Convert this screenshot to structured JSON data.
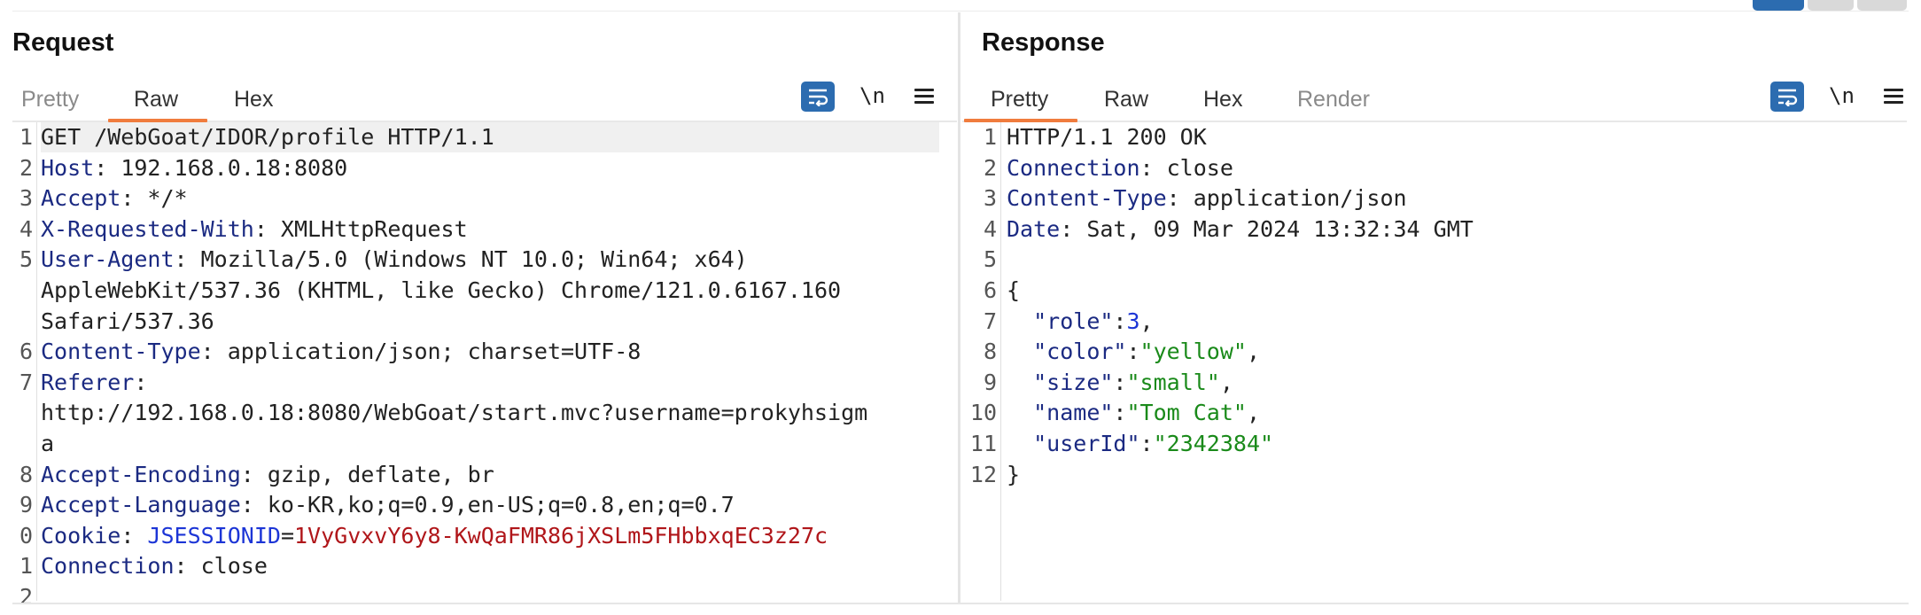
{
  "request": {
    "title": "Request",
    "tabs": [
      {
        "label": "Pretty",
        "muted": true
      },
      {
        "label": "Raw",
        "active": true
      },
      {
        "label": "Hex"
      }
    ],
    "newline_label": "\\n",
    "lines": [
      {
        "num": "1",
        "parts": [
          {
            "t": "GET /WebGoat/IDOR/profile HTTP/1.1",
            "c": "v"
          }
        ]
      },
      {
        "num": "2",
        "parts": [
          {
            "t": "Host",
            "c": "k"
          },
          {
            "t": ": 192.168.0.18:8080",
            "c": "v"
          }
        ]
      },
      {
        "num": "3",
        "parts": [
          {
            "t": "Accept",
            "c": "k"
          },
          {
            "t": ": */*",
            "c": "v"
          }
        ]
      },
      {
        "num": "4",
        "parts": [
          {
            "t": "X-Requested-With",
            "c": "k"
          },
          {
            "t": ": XMLHttpRequest",
            "c": "v"
          }
        ]
      },
      {
        "num": "5",
        "parts": [
          {
            "t": "User-Agent",
            "c": "k"
          },
          {
            "t": ": Mozilla/5.0 (Windows NT 10.0; Win64; x64)",
            "c": "v"
          }
        ]
      },
      {
        "num": "",
        "parts": [
          {
            "t": "AppleWebKit/537.36 (KHTML, like Gecko) Chrome/121.0.6167.160",
            "c": "v"
          }
        ]
      },
      {
        "num": "",
        "parts": [
          {
            "t": "Safari/537.36",
            "c": "v"
          }
        ]
      },
      {
        "num": "6",
        "parts": [
          {
            "t": "Content-Type",
            "c": "k"
          },
          {
            "t": ": application/json; charset=UTF-8",
            "c": "v"
          }
        ]
      },
      {
        "num": "7",
        "parts": [
          {
            "t": "Referer",
            "c": "k"
          },
          {
            "t": ":",
            "c": "v"
          }
        ]
      },
      {
        "num": "",
        "parts": [
          {
            "t": "http://192.168.0.18:8080/WebGoat/start.mvc?username=prokyhsigm",
            "c": "v"
          }
        ]
      },
      {
        "num": "",
        "parts": [
          {
            "t": "a",
            "c": "v"
          }
        ]
      },
      {
        "num": "8",
        "parts": [
          {
            "t": "Accept-Encoding",
            "c": "k"
          },
          {
            "t": ": gzip, deflate, br",
            "c": "v"
          }
        ]
      },
      {
        "num": "9",
        "parts": [
          {
            "t": "Accept-Language",
            "c": "k"
          },
          {
            "t": ": ko-KR,ko;q=0.9,en-US;q=0.8,en;q=0.7",
            "c": "v"
          }
        ]
      },
      {
        "num": "0",
        "parts": [
          {
            "t": "Cookie",
            "c": "k"
          },
          {
            "t": ": ",
            "c": "v"
          },
          {
            "t": "JSESSIONID",
            "c": "cookie-name"
          },
          {
            "t": "=",
            "c": "v"
          },
          {
            "t": "1VyGvxvY6y8-KwQaFMR86jXSLm5FHbbxqEC3z27c",
            "c": "cookie-val"
          }
        ]
      },
      {
        "num": "1",
        "parts": [
          {
            "t": "Connection",
            "c": "k"
          },
          {
            "t": ": close",
            "c": "v"
          }
        ]
      },
      {
        "num": "2",
        "parts": []
      }
    ]
  },
  "response": {
    "title": "Response",
    "tabs": [
      {
        "label": "Pretty",
        "active": true
      },
      {
        "label": "Raw"
      },
      {
        "label": "Hex"
      },
      {
        "label": "Render",
        "muted": true
      }
    ],
    "newline_label": "\\n",
    "lines": [
      {
        "num": "1",
        "parts": [
          {
            "t": "HTTP/1.1 200 OK",
            "c": "v"
          }
        ]
      },
      {
        "num": "2",
        "parts": [
          {
            "t": "Connection",
            "c": "k"
          },
          {
            "t": ": close",
            "c": "v"
          }
        ]
      },
      {
        "num": "3",
        "parts": [
          {
            "t": "Content-Type",
            "c": "k"
          },
          {
            "t": ": application/json",
            "c": "v"
          }
        ]
      },
      {
        "num": "4",
        "parts": [
          {
            "t": "Date",
            "c": "k"
          },
          {
            "t": ": Sat, 09 Mar 2024 13:32:34 GMT",
            "c": "v"
          }
        ]
      },
      {
        "num": "5",
        "parts": []
      },
      {
        "num": "6",
        "parts": [
          {
            "t": "{",
            "c": "v"
          }
        ]
      },
      {
        "num": "7",
        "parts": [
          {
            "t": "  ",
            "c": "v"
          },
          {
            "t": "\"role\"",
            "c": "jkey"
          },
          {
            "t": ":",
            "c": "v"
          },
          {
            "t": "3",
            "c": "jnum"
          },
          {
            "t": ",",
            "c": "v"
          }
        ]
      },
      {
        "num": "8",
        "parts": [
          {
            "t": "  ",
            "c": "v"
          },
          {
            "t": "\"color\"",
            "c": "jkey"
          },
          {
            "t": ":",
            "c": "v"
          },
          {
            "t": "\"yellow\"",
            "c": "jstr"
          },
          {
            "t": ",",
            "c": "v"
          }
        ]
      },
      {
        "num": "9",
        "parts": [
          {
            "t": "  ",
            "c": "v"
          },
          {
            "t": "\"size\"",
            "c": "jkey"
          },
          {
            "t": ":",
            "c": "v"
          },
          {
            "t": "\"small\"",
            "c": "jstr"
          },
          {
            "t": ",",
            "c": "v"
          }
        ]
      },
      {
        "num": "10",
        "parts": [
          {
            "t": "  ",
            "c": "v"
          },
          {
            "t": "\"name\"",
            "c": "jkey"
          },
          {
            "t": ":",
            "c": "v"
          },
          {
            "t": "\"Tom Cat\"",
            "c": "jstr"
          },
          {
            "t": ",",
            "c": "v"
          }
        ]
      },
      {
        "num": "11",
        "parts": [
          {
            "t": "  ",
            "c": "v"
          },
          {
            "t": "\"userId\"",
            "c": "jkey"
          },
          {
            "t": ":",
            "c": "v"
          },
          {
            "t": "\"2342384\"",
            "c": "jstr"
          }
        ]
      },
      {
        "num": "12",
        "parts": [
          {
            "t": "}",
            "c": "v"
          }
        ]
      }
    ]
  },
  "icons": {
    "wrap": "wrap-lines-icon",
    "newline": "newline-toggle-icon",
    "menu": "hamburger-menu-icon"
  },
  "colors": {
    "accent_tab": "#f07c3e",
    "wrap_button": "#2c6cb0",
    "header_key": "#1b2a82",
    "cookie_name": "#1c35d6",
    "cookie_value": "#b0161a",
    "json_string": "#1a8a1a"
  }
}
